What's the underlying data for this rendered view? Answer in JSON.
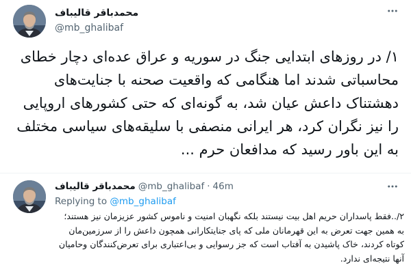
{
  "main_tweet": {
    "author_name": "محمدباقر قالیباف",
    "handle": "@mb_ghalibaf",
    "text": "۱/ در روزهای ابتدایی جنگ در سوریه و عراق عده‌ای دچار خطای محاسباتی شدند اما هنگامی که واقعیت صحنه با جنایت‌های دهشتناک داعش عیان شد، به گونه‌ای که حتی کشورهای اروپایی را نیز نگران کرد، هر ایرانی منصفی با سلیقه‌های سیاسی مختلف به این باور رسید که مدافعان حرم ..."
  },
  "reply_tweet": {
    "author_name": "محمدباقر قالیباف",
    "handle": "@mb_ghalibaf",
    "separator": "·",
    "time": "46m",
    "replying_prefix": "Replying to",
    "replying_to": "@mb_ghalibaf",
    "text": "۲/..فقط پاسداران حریم اهل بیت نیستند بلکه نگهبان امنیت و ناموس کشور عزیزمان نیز هستند؛ به همین جهت تعرض به این قهرمانان ملی که پای جنایتکارانی همچون داعش را از سرزمین‌مان کوتاه کردند، خاک پاشیدن به آفتاب است که جز رسوایی و بی‌اعتباری برای تعرض‌کنندگان وحامیان آنها نتیجه‌ای ندارد."
  },
  "icons": {
    "more": "more-horizontal-icon",
    "avatar": "profile-photo"
  },
  "colors": {
    "text": "#0f1419",
    "secondary": "#536471",
    "link": "#1d9bf0",
    "divider": "#eff3f4"
  }
}
